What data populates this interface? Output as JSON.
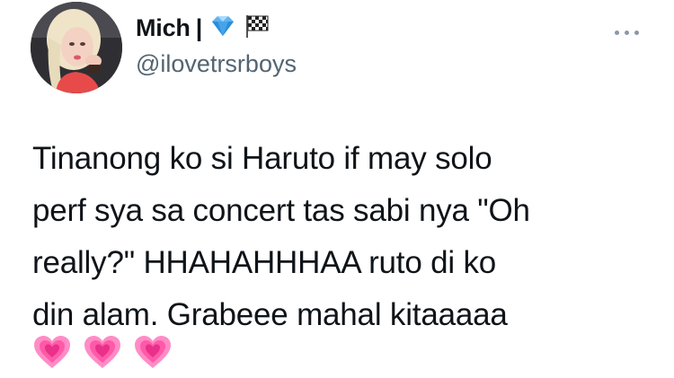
{
  "author": {
    "display_name": "Mich",
    "separator": "|",
    "badges": [
      "gem-icon",
      "chequered-flag-icon"
    ],
    "handle": "@ilovetrsrboys",
    "avatar": "profile-photo"
  },
  "menu": {
    "icon": "more-icon"
  },
  "tweet": {
    "lines": [
      "Tinanong ko si Haruto if may solo",
      "perf sya sa concert tas sabi nya \"Oh",
      "really?\" HHAHAHHHAA ruto di ko",
      "din alam. Grabeee mahal kitaaaaa"
    ],
    "emojis": [
      "growing-heart-icon",
      "growing-heart-icon",
      "growing-heart-icon"
    ]
  },
  "colors": {
    "text": "#0f1419",
    "secondary": "#536471",
    "heart": "#ff5fb0"
  }
}
